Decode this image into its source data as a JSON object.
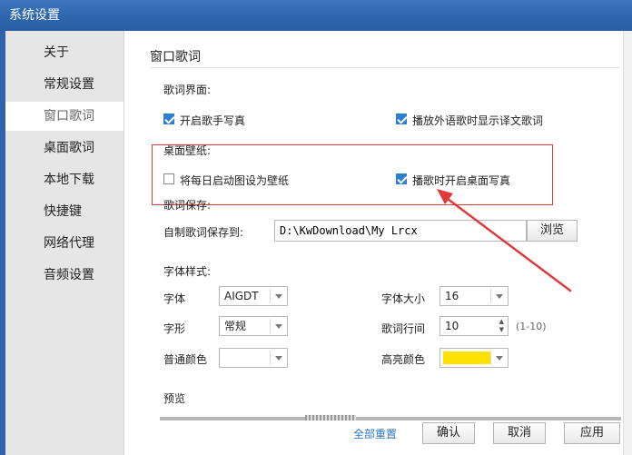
{
  "window": {
    "title": "系统设置"
  },
  "sidebar": {
    "items": [
      {
        "label": "关于"
      },
      {
        "label": "常规设置"
      },
      {
        "label": "窗口歌词"
      },
      {
        "label": "桌面歌词"
      },
      {
        "label": "本地下载"
      },
      {
        "label": "快捷键"
      },
      {
        "label": "网络代理"
      },
      {
        "label": "音频设置"
      }
    ]
  },
  "main": {
    "page_title": "窗口歌词",
    "lyrics_ui": {
      "section_label": "歌词界面:",
      "open_singer_photo": {
        "label": "开启歌手写真",
        "checked": true
      },
      "show_translation": {
        "label": "播放外语歌时显示译文歌词",
        "checked": true
      }
    },
    "wallpaper": {
      "section_label": "桌面壁纸:",
      "daily_startup_wallpaper": {
        "label": "将每日启动图设为壁纸",
        "checked": false
      },
      "desktop_photo_on_play": {
        "label": "播歌时开启桌面写真",
        "checked": true
      }
    },
    "save": {
      "section_label": "歌词保存:",
      "path_label": "自制歌词保存到:",
      "path_value": "D:\\KwDownload\\My Lrcx",
      "browse_label": "浏览"
    },
    "font": {
      "section_label": "字体样式:",
      "font_label": "字体",
      "font_value": "AIGDT",
      "size_label": "字体大小",
      "size_value": "16",
      "style_label": "字形",
      "style_value": "常规",
      "line_spacing_label": "歌词行间",
      "line_spacing_value": "10",
      "line_spacing_range": "(1-10)",
      "normal_color_label": "普通颜色",
      "highlight_color_label": "高亮颜色",
      "highlight_color": "#ffe100"
    },
    "preview": {
      "label": "预览"
    }
  },
  "footer": {
    "reset_label": "全部重置",
    "ok_label": "确认",
    "cancel_label": "取消",
    "apply_label": "应用"
  },
  "colors": {
    "annotation": "#e03b3b",
    "accent": "#2f7fd0"
  }
}
